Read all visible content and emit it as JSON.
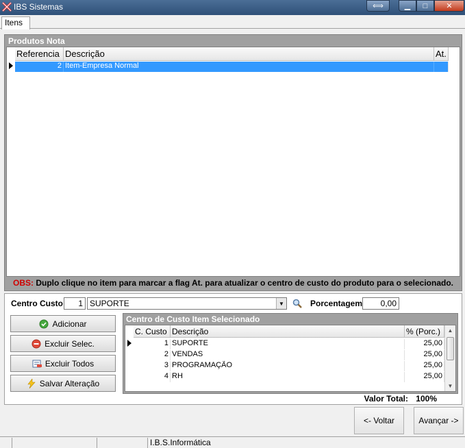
{
  "window": {
    "title": "IBS Sistemas"
  },
  "tabs": [
    {
      "label": "Itens"
    }
  ],
  "produtos": {
    "caption": "Produtos Nota",
    "columns": [
      "Referencia",
      "Descrição",
      "At."
    ],
    "rows": [
      {
        "referencia": "2",
        "descricao": "Item-Empresa Normal",
        "at": ""
      }
    ],
    "obs_prefix": "OBS:",
    "obs_text": " Duplo clique no item para marcar a flag At. para atualizar o centro de custo do produto para o selecionado."
  },
  "form": {
    "centro_custo_label": "Centro Custo",
    "centro_custo_code": "1",
    "centro_custo_value": "SUPORTE",
    "porcentagem_label": "Porcentagem",
    "porcentagem_value": "0,00"
  },
  "actions": {
    "adicionar": "Adicionar",
    "excluir_selec": "Excluir Selec.",
    "excluir_todos": "Excluir Todos",
    "salvar": "Salvar Alteração"
  },
  "centros": {
    "caption": "Centro de Custo Item Selecionado",
    "columns": [
      "C. Custo",
      "Descrição",
      "% (Porc.)"
    ],
    "rows": [
      {
        "codigo": "1",
        "descricao": "SUPORTE",
        "porc": "25,00"
      },
      {
        "codigo": "2",
        "descricao": "VENDAS",
        "porc": "25,00"
      },
      {
        "codigo": "3",
        "descricao": "PROGRAMAÇÃO",
        "porc": "25,00"
      },
      {
        "codigo": "4",
        "descricao": "RH",
        "porc": "25,00"
      }
    ]
  },
  "total": {
    "label": "Valor Total:",
    "value": "100%"
  },
  "nav": {
    "voltar": "<- Voltar",
    "avancar": "Avançar ->"
  },
  "status": {
    "company": "I.B.S.Informática"
  },
  "colors": {
    "selection": "#3399ff",
    "panel": "#a0a0a0",
    "obs_red": "#d00000"
  }
}
